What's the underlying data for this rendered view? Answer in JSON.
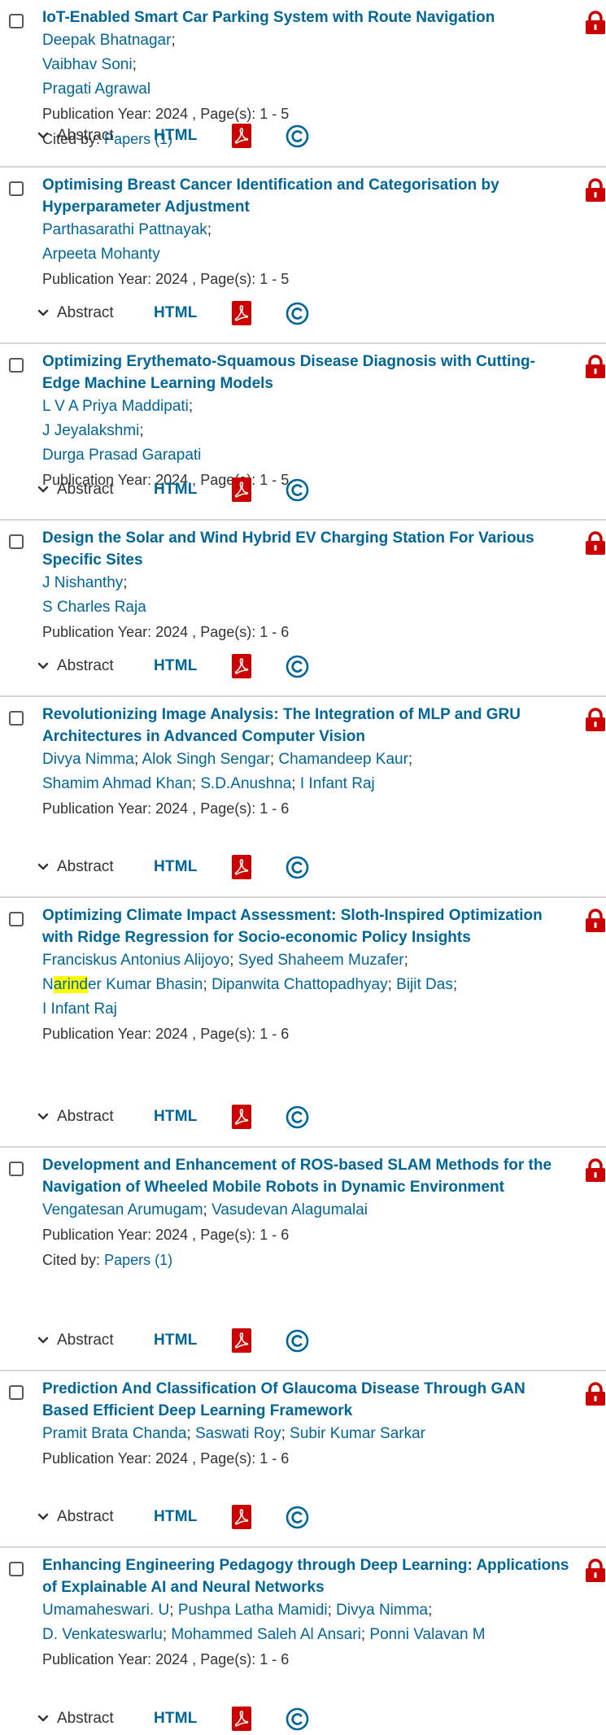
{
  "results": [
    {
      "title": "IoT-Enabled Smart Car Parking System with Route Navigation",
      "authors": [
        [
          "Deepak Bhatnagar"
        ],
        [
          "Vaibhav Soni"
        ],
        [
          "Pragati Agrawal"
        ]
      ],
      "pub_year_label": "Publication Year:",
      "year": "2024",
      "pages_label": "Page(s):",
      "pages": "1 - 5",
      "cited_label": "Cited by:",
      "cited_link": "Papers (1)"
    },
    {
      "title": "Optimising Breast Cancer Identification and Categorisation by Hyperparameter Adjustment",
      "authors": [
        [
          "Parthasarathi Pattnayak"
        ],
        [
          "Arpeeta Mohanty"
        ]
      ],
      "pub_year_label": "Publication Year:",
      "year": "2024",
      "pages_label": "Page(s):",
      "pages": "1 - 5"
    },
    {
      "title": "Optimizing Erythemato-Squamous Disease Diagnosis with Cutting-Edge Machine Learning Models",
      "authors": [
        [
          "L V A Priya Maddipati"
        ],
        [
          "J Jeyalakshmi"
        ],
        [
          "Durga Prasad Garapati"
        ]
      ],
      "pub_year_label": "Publication Year:",
      "year": "2024",
      "pages_label": "Page(s):",
      "pages": "1 - 5"
    },
    {
      "title": "Design the Solar and Wind Hybrid EV Charging Station For Various Specific Sites",
      "authors": [
        [
          "J Nishanthy"
        ],
        [
          "S Charles Raja"
        ]
      ],
      "pub_year_label": "Publication Year:",
      "year": "2024",
      "pages_label": "Page(s):",
      "pages": "1 - 6"
    },
    {
      "title": "Revolutionizing Image Analysis: The Integration of MLP and GRU Architectures in Advanced Computer Vision",
      "authors": [
        [
          "Divya Nimma",
          "Alok Singh Sengar",
          "Chamandeep Kaur"
        ],
        [
          "Shamim Ahmad Khan",
          "S.D.Anushna",
          "I Infant Raj"
        ]
      ],
      "pub_year_label": "Publication Year:",
      "year": "2024",
      "pages_label": "Page(s):",
      "pages": "1 - 6"
    },
    {
      "title": "Optimizing Climate Impact Assessment: Sloth-Inspired Optimization with Ridge Regression for Socio-economic Policy Insights",
      "authors": [
        [
          "Franciskus Antonius Alijoyo",
          "Syed Shaheem Muzafer"
        ],
        [
          "Narinder Kumar Bhasin",
          "Dipanwita Chattopadhyay",
          "Bijit Das"
        ],
        [
          "I Infant Raj"
        ]
      ],
      "highlight": {
        "pre": "N",
        "mark": "arind",
        "post": "er Kumar Bhasin"
      },
      "pub_year_label": "Publication Year:",
      "year": "2024",
      "pages_label": "Page(s):",
      "pages": "1 - 6"
    },
    {
      "title": "Development and Enhancement of ROS-based SLAM Methods for the Navigation of Wheeled Mobile Robots in Dynamic Environment",
      "authors": [
        [
          "Vengatesan Arumugam",
          "Vasudevan Alagumalai"
        ]
      ],
      "pub_year_label": "Publication Year:",
      "year": "2024",
      "pages_label": "Page(s):",
      "pages": "1 - 6",
      "cited_label": "Cited by:",
      "cited_link": "Papers (1)"
    },
    {
      "title": "Prediction And Classification Of Glaucoma Disease Through GAN Based Efficient Deep Learning Framework",
      "authors": [
        [
          "Pramit Brata Chanda",
          "Saswati Roy",
          "Subir Kumar Sarkar"
        ]
      ],
      "pub_year_label": "Publication Year:",
      "year": "2024",
      "pages_label": "Page(s):",
      "pages": "1 - 6"
    },
    {
      "title": "Enhancing Engineering Pedagogy through Deep Learning: Applications of Explainable AI and Neural Networks",
      "authors": [
        [
          "Umamaheswari. U",
          "Pushpa Latha Mamidi",
          "Divya Nimma"
        ],
        [
          "D. Venkateswarlu",
          "Mohammed Saleh Al Ansari",
          "Ponni Valavan M"
        ]
      ],
      "pub_year_label": "Publication Year:",
      "year": "2024",
      "pages_label": "Page(s):",
      "pages": "1 - 6"
    }
  ],
  "actions": {
    "abstract_label": "Abstract",
    "html_label": "HTML"
  },
  "icons": {
    "lock": "lock-icon",
    "pdf": "pdf-icon",
    "rights": "copyright-icon",
    "chevron": "chevron-down-icon"
  },
  "colors": {
    "link": "#006699",
    "text": "#333333",
    "lock": "#cc0000",
    "pdf": "#cc0000",
    "highlight": "#ffff00",
    "divider": "#d3d6d9"
  }
}
